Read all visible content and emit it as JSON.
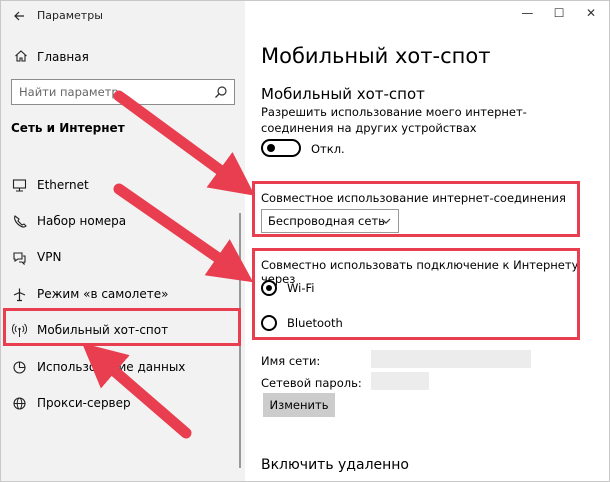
{
  "window": {
    "title": "Параметры",
    "controls": [
      "—",
      "☐",
      "✕"
    ]
  },
  "sidebar": {
    "home_label": "Главная",
    "search_placeholder": "Найти параметр",
    "section_title": "Сеть и Интернет",
    "items": [
      {
        "label": "Ethernet",
        "icon": "ethernet-icon"
      },
      {
        "label": "Набор номера",
        "icon": "dialup-icon"
      },
      {
        "label": "VPN",
        "icon": "vpn-icon"
      },
      {
        "label": "Режим «в самолете»",
        "icon": "airplane-icon"
      },
      {
        "label": "Мобильный хот-спот",
        "icon": "hotspot-icon"
      },
      {
        "label": "Использование данных",
        "icon": "data-usage-icon"
      },
      {
        "label": "Прокси-сервер",
        "icon": "globe-icon"
      }
    ]
  },
  "main": {
    "page_title": "Мобильный хот-спот",
    "sub_title": "Мобильный хот-спот",
    "description": "Разрешить использование моего интернет-соединения на других устройствах",
    "toggle_state": "Откл.",
    "share_label": "Совместное использование интернет-соединения",
    "share_value": "Беспроводная сеть",
    "via_label": "Совместно использовать подключение к Интернету через",
    "options": [
      {
        "label": "Wi-Fi",
        "selected": true
      },
      {
        "label": "Bluetooth",
        "selected": false
      }
    ],
    "network_name_label": "Имя сети:",
    "network_password_label": "Сетевой пароль:",
    "change_button": "Изменить",
    "remote_title": "Включить удаленно"
  },
  "colors": {
    "highlight": "#e83e4f",
    "sidebar_bg": "#f2f2f2",
    "button_bg": "#cccccc"
  }
}
